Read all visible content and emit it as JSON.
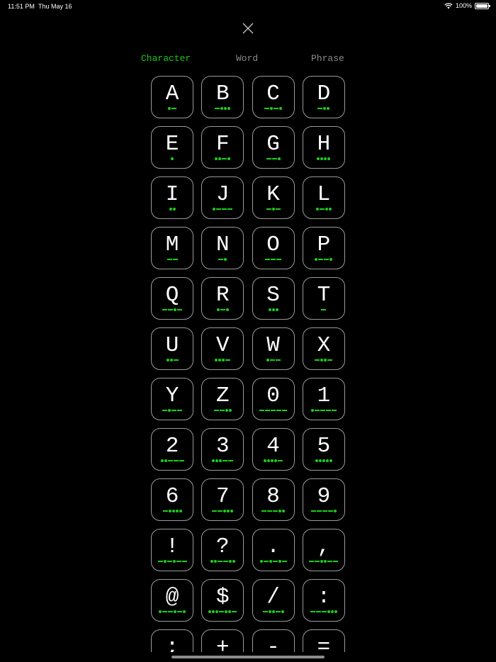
{
  "status_bar": {
    "time": "11:51 PM",
    "date": "Thu May 16",
    "battery": "100%"
  },
  "close_icon": "close-icon",
  "tabs": [
    {
      "label": "Character",
      "active": true
    },
    {
      "label": "Word",
      "active": false
    },
    {
      "label": "Phrase",
      "active": false
    }
  ],
  "colors": {
    "accent": "#19d019",
    "inactive_tab": "#8a8a8a",
    "key_border": "#9a9a9a",
    "background": "#000000"
  },
  "keys": [
    {
      "char": "A",
      "morse": ".-"
    },
    {
      "char": "B",
      "morse": "-..."
    },
    {
      "char": "C",
      "morse": "-.-."
    },
    {
      "char": "D",
      "morse": "-.."
    },
    {
      "char": "E",
      "morse": "."
    },
    {
      "char": "F",
      "morse": "..-."
    },
    {
      "char": "G",
      "morse": "--."
    },
    {
      "char": "H",
      "morse": "...."
    },
    {
      "char": "I",
      "morse": ".."
    },
    {
      "char": "J",
      "morse": ".---"
    },
    {
      "char": "K",
      "morse": "-.-"
    },
    {
      "char": "L",
      "morse": ".-.."
    },
    {
      "char": "M",
      "morse": "--"
    },
    {
      "char": "N",
      "morse": "-."
    },
    {
      "char": "O",
      "morse": "---"
    },
    {
      "char": "P",
      "morse": ".--."
    },
    {
      "char": "Q",
      "morse": "--.-"
    },
    {
      "char": "R",
      "morse": ".-."
    },
    {
      "char": "S",
      "morse": "..."
    },
    {
      "char": "T",
      "morse": "-"
    },
    {
      "char": "U",
      "morse": "..-"
    },
    {
      "char": "V",
      "morse": "...-"
    },
    {
      "char": "W",
      "morse": ".--"
    },
    {
      "char": "X",
      "morse": "-..-"
    },
    {
      "char": "Y",
      "morse": "-.--"
    },
    {
      "char": "Z",
      "morse": "--.."
    },
    {
      "char": "0",
      "morse": "-----"
    },
    {
      "char": "1",
      "morse": ".----"
    },
    {
      "char": "2",
      "morse": "..---"
    },
    {
      "char": "3",
      "morse": "...--"
    },
    {
      "char": "4",
      "morse": "....-"
    },
    {
      "char": "5",
      "morse": "....."
    },
    {
      "char": "6",
      "morse": "-...."
    },
    {
      "char": "7",
      "morse": "--..."
    },
    {
      "char": "8",
      "morse": "---.."
    },
    {
      "char": "9",
      "morse": "----."
    },
    {
      "char": "!",
      "morse": "-.-.--"
    },
    {
      "char": "?",
      "morse": "..--.."
    },
    {
      "char": ".",
      "morse": ".-.-.-"
    },
    {
      "char": ",",
      "morse": "--..--"
    },
    {
      "char": "@",
      "morse": ".--.-."
    },
    {
      "char": "$",
      "morse": "...-..-"
    },
    {
      "char": "/",
      "morse": "-..-."
    },
    {
      "char": ":",
      "morse": "---..."
    },
    {
      "char": ";",
      "morse": "-.-.-."
    },
    {
      "char": "+",
      "morse": ".-.-."
    },
    {
      "char": "-",
      "morse": "-....-"
    },
    {
      "char": "=",
      "morse": "-...-"
    }
  ]
}
